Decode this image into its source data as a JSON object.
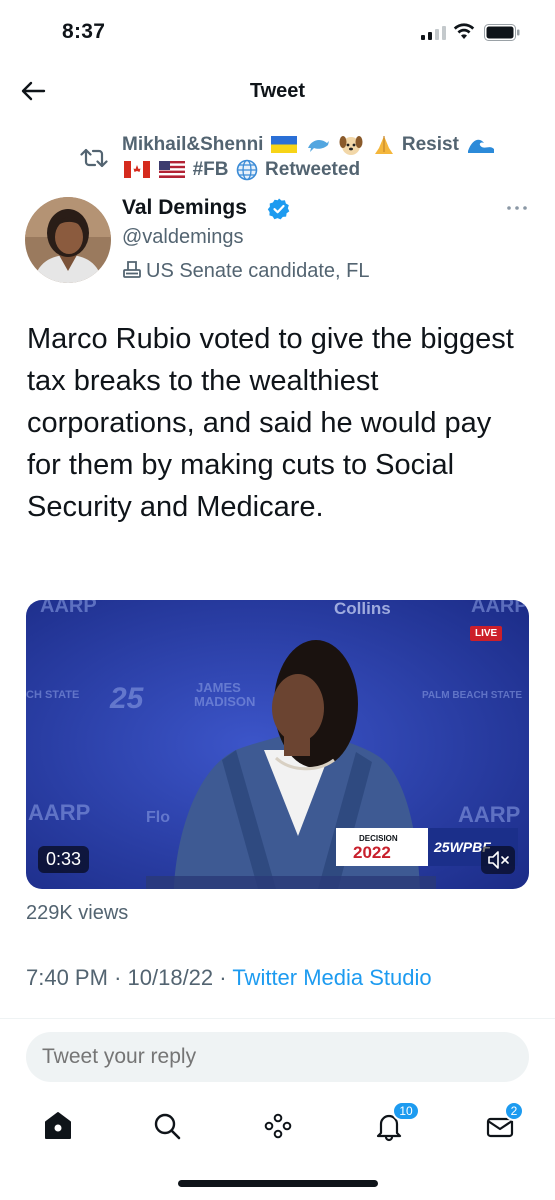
{
  "status_bar": {
    "time": "8:37"
  },
  "header": {
    "title": "Tweet"
  },
  "retweet_context": {
    "line1_name": "Mikhail&Shenni",
    "line1_after": "Resist",
    "line2_tag": "#FB",
    "line2_suffix": "Retweeted"
  },
  "author": {
    "name": "Val Demings",
    "handle": "@valdemings",
    "label": "US Senate candidate, FL"
  },
  "tweet": {
    "text": "Marco Rubio voted to give the biggest tax breaks to the wealthiest corporations, and said he would pay for them by making cuts to Social Security and Medicare."
  },
  "video": {
    "duration": "0:33",
    "live_label": "LIVE",
    "bg_text_1": "AARP",
    "bg_text_2": "Collins",
    "bg_text_3": "25",
    "decision_text": "DECISION",
    "decision_year": "2022",
    "channel": "25WPBF"
  },
  "stats": {
    "views": "229K views"
  },
  "meta": {
    "time": "7:40 PM",
    "date": "10/18/22",
    "source": "Twitter Media Studio"
  },
  "reply": {
    "placeholder": "Tweet your reply"
  },
  "nav": {
    "notifications_badge": "10",
    "messages_badge": "2"
  },
  "colors": {
    "accent": "#1d9bf0",
    "text_secondary": "#536471",
    "live_red": "#cc1f2a"
  }
}
